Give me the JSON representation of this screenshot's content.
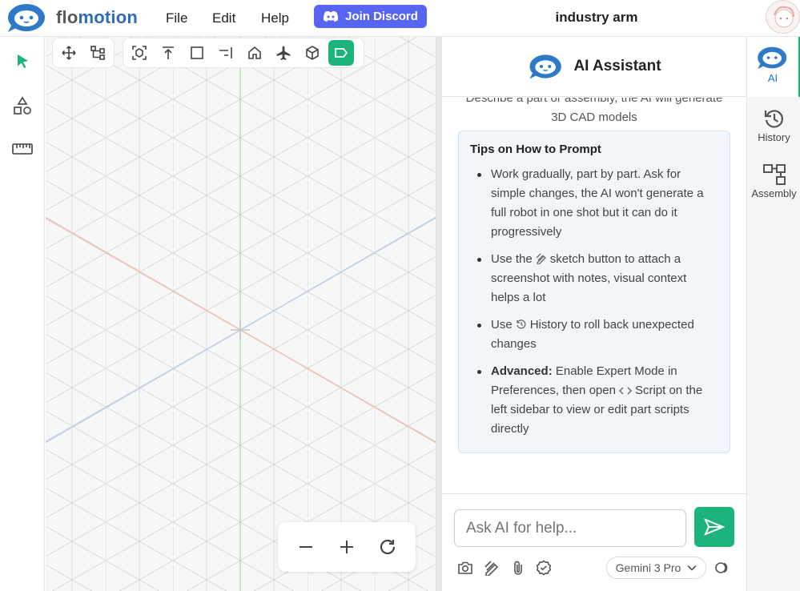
{
  "app": {
    "brand_part1": "flo",
    "brand_part2": "motion",
    "document_title": "industry arm"
  },
  "menu": {
    "file": "File",
    "edit": "Edit",
    "help": "Help",
    "discord": "Join Discord"
  },
  "left_sidebar": {
    "icons": [
      "select-arrow-icon",
      "shapes-icon",
      "ruler-icon"
    ]
  },
  "viewport_toolbar": {
    "group1": [
      "move-icon",
      "hierarchy-icon"
    ],
    "group2": [
      "frame-icon",
      "align-top-icon",
      "square-icon",
      "align-right-icon",
      "home-icon",
      "airplane-icon",
      "cube-icon",
      "tag-icon"
    ],
    "active": "tag-icon"
  },
  "zoom": {
    "minus": "−",
    "plus": "+",
    "reset": "refresh-icon"
  },
  "assistant": {
    "title": "AI Assistant",
    "intro": "Describe a part or assembly, the AI will generate 3D CAD models",
    "tips": {
      "heading": "Tips on How to Prompt",
      "item1": "Work gradually, part by part. Ask for simple changes, the AI won't generate a full robot in one shot but it can do it progressively",
      "item2_before": "Use the",
      "item2_after": "sketch button to attach a screenshot with notes, visual context helps a lot",
      "item3_before": "Use",
      "item3_after": "History to roll back unexpected changes",
      "item4_bold": "Advanced:",
      "item4_a": "Enable Expert Mode in Preferences, then open",
      "item4_b": "Script on the left sidebar to view or edit part scripts directly"
    },
    "input_placeholder": "Ask AI for help...",
    "model": "Gemini 3 Pro",
    "accent": "#1db47c"
  },
  "right_rail": {
    "ai": "AI",
    "history": "History",
    "assembly": "Assembly"
  },
  "colors": {
    "discord": "#5865f2",
    "accent": "#1db47c",
    "brand_blue": "#2e6db4",
    "axis_red": "#f2b9b0",
    "axis_blue": "#b9cbe9",
    "axis_green": "#b6dcb0"
  }
}
